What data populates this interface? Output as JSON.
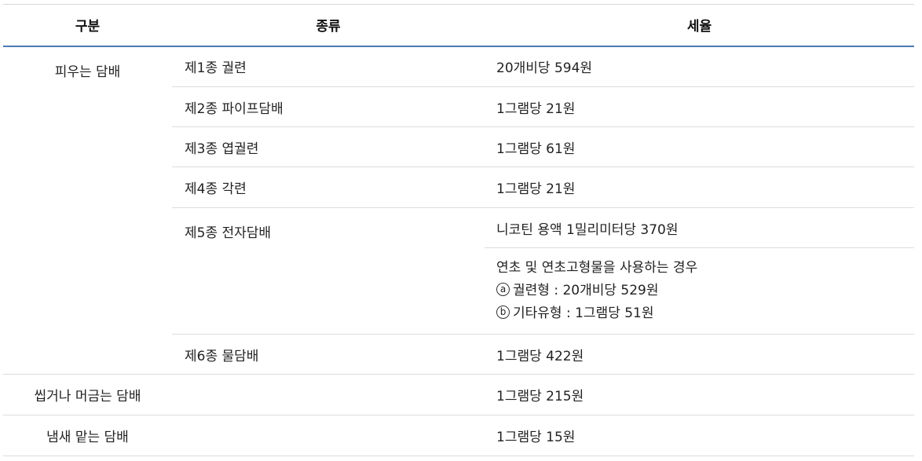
{
  "header": {
    "col1": "구분",
    "col2": "종류",
    "col3": "세율"
  },
  "smoking": {
    "category": "피우는 담배",
    "items": [
      {
        "kind": "제1종 궐련",
        "rate": "20개비당 594원"
      },
      {
        "kind": "제2종  파이프담배",
        "rate": "1그램당 21원"
      },
      {
        "kind": "제3종  엽궐련",
        "rate": "1그램당 61원"
      },
      {
        "kind": "제4종  각련",
        "rate": "1그램당 21원"
      },
      {
        "kind": "제5종  전자담배",
        "rate": "니코틴 용액 1밀리미터당 370원"
      },
      {
        "kind": "제6종  물담배",
        "rate": "1그램당 422원"
      }
    ],
    "ecig_extra": {
      "line1": "연초 및 연초고형물을 사용하는 경우",
      "a_mark": "a",
      "a_text": "궐련형 : 20개비당 529원",
      "b_mark": "b",
      "b_text": "기타유형 : 1그램당 51원"
    }
  },
  "chewing": {
    "category": "씹거나 머금는 담배",
    "rate": "1그램당 215원"
  },
  "snuff": {
    "category": "냄새 맡는 담배",
    "rate": "1그램당 15원"
  }
}
